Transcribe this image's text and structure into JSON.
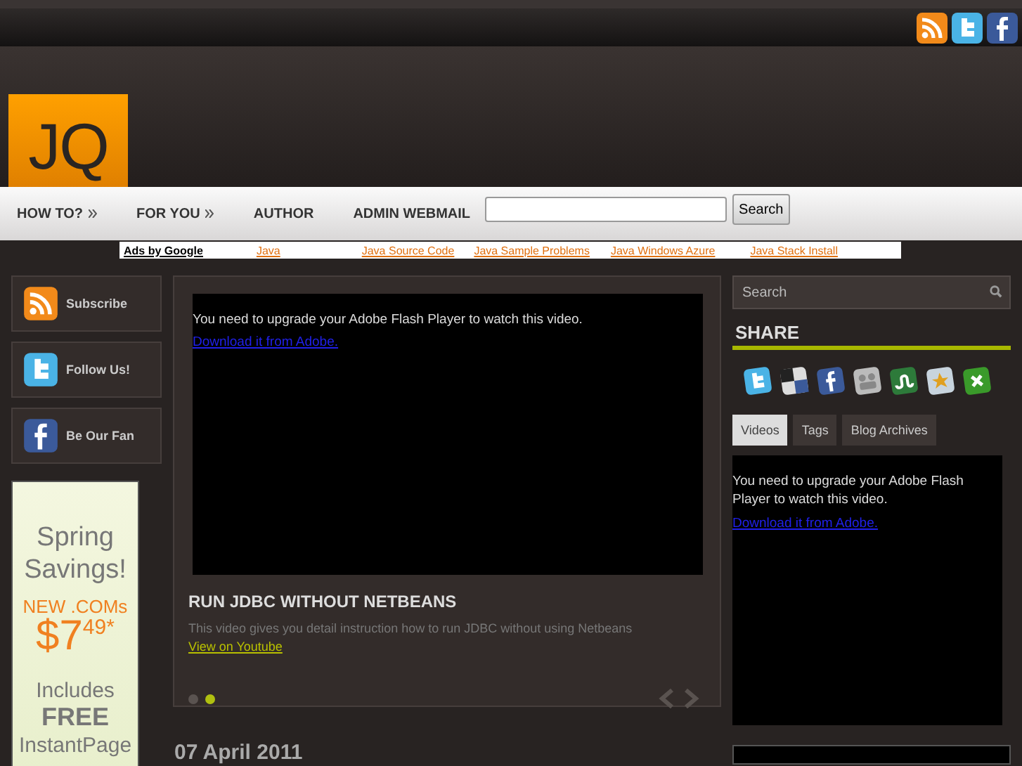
{
  "logo": {
    "text": "JQ"
  },
  "nav": {
    "items": [
      {
        "label": "HOW TO?",
        "submenu": true
      },
      {
        "label": "FOR YOU",
        "submenu": true
      },
      {
        "label": "AUTHOR",
        "submenu": false
      },
      {
        "label": "ADMIN WEBMAIL",
        "submenu": false
      }
    ],
    "search_button": "Search"
  },
  "ads": {
    "title": "Ads by Google",
    "links": [
      "Java",
      "Java Source Code",
      "Java Sample Problems",
      "Java Windows Azure",
      "Java Stack Install"
    ]
  },
  "social_buttons": [
    {
      "kind": "rss",
      "label": "Subscribe"
    },
    {
      "kind": "twitter",
      "label": "Follow Us!"
    },
    {
      "kind": "facebook",
      "label": "Be Our Fan"
    }
  ],
  "banner": {
    "lines": [
      "Spring",
      "Savings!"
    ],
    "offer": "NEW .COMs",
    "price": "$7",
    "cents": "49",
    "mark": "*",
    "footer": [
      "Includes",
      "FREE",
      "InstantPage"
    ]
  },
  "featured": {
    "flash_message": "You need to upgrade your Adobe Flash Player to watch this video.",
    "flash_link": "Download it from Adobe.",
    "title": "RUN JDBC WITHOUT NETBEANS",
    "description": "This video gives you detail instruction how to run JDBC without using Netbeans",
    "link": "View on Youtube",
    "dots": [
      {
        "selected": false
      },
      {
        "selected": true
      }
    ]
  },
  "post_date": "07 April 2011",
  "sidebar": {
    "search_placeholder": "Search",
    "share_title": "SHARE",
    "share_icons": [
      {
        "kind": "twitter"
      },
      {
        "kind": "delicious"
      },
      {
        "kind": "facebook"
      },
      {
        "kind": "myspace"
      },
      {
        "kind": "stumbleupon"
      },
      {
        "kind": "favorite"
      },
      {
        "kind": "plus"
      }
    ],
    "tabs": [
      {
        "label": "Videos",
        "selected": true
      },
      {
        "label": "Tags",
        "selected": false
      },
      {
        "label": "Blog Archives",
        "selected": false
      }
    ],
    "flash_message": "You need to upgrade your Adobe Flash Player to watch this video.",
    "flash_link": "Download it from Adobe."
  }
}
